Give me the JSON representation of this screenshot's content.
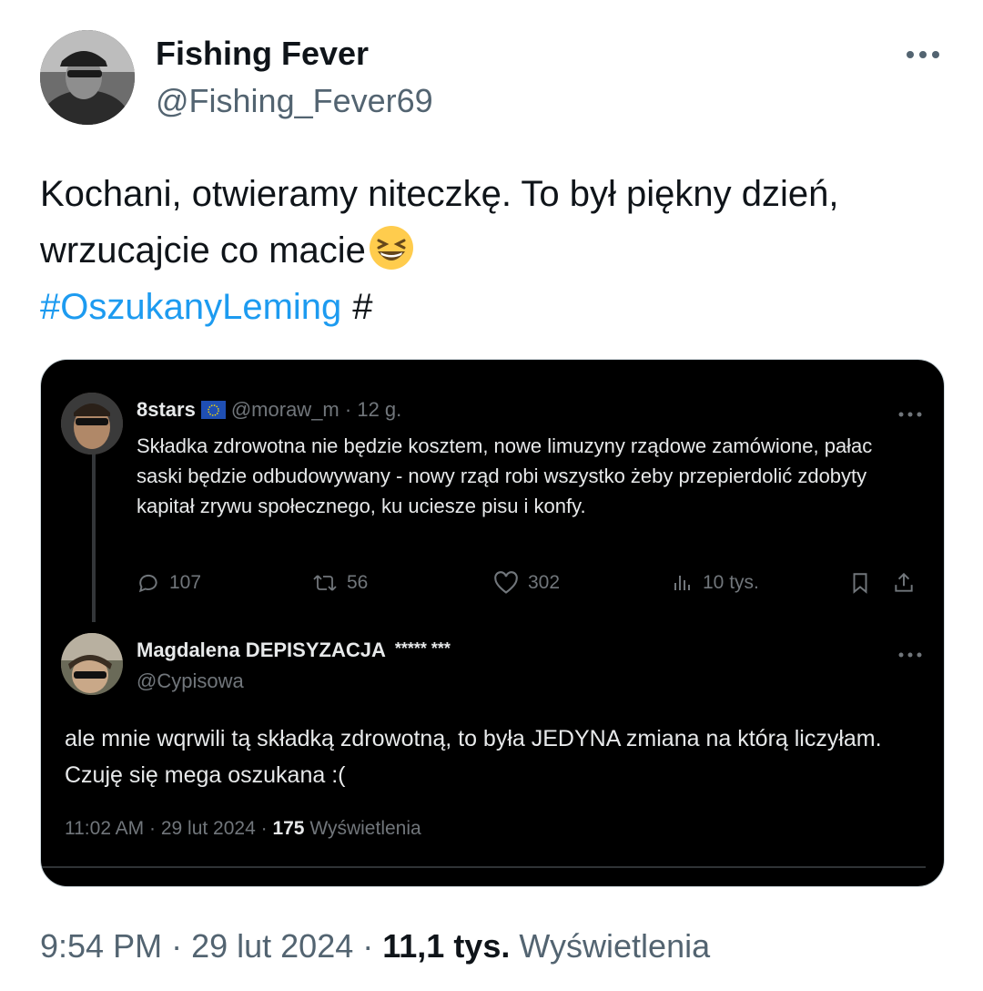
{
  "author": {
    "name": "Fishing Fever",
    "handle": "@Fishing_Fever69"
  },
  "tweet": {
    "text_line1": "Kochani, otwieramy niteczkę. To był piękny dzień,",
    "text_line2": "wrzucajcie co macie",
    "emoji": "laughing-emoji",
    "hashtag": "#OszukanyLeming",
    "extra_hash": "#"
  },
  "embedded": {
    "quoted": {
      "name": "8stars",
      "badge": "eu-flag-icon",
      "handle": "@moraw_m",
      "separator": "·",
      "age": "12 g.",
      "text": "Składka zdrowotna nie będzie kosztem, nowe limuzyny rządowe zamówione, pałac saski będzie odbudowywany - nowy rząd robi wszystko żeby przepierdolić zdobyty kapitał zrywu społecznego, ku uciesze pisu i konfy.",
      "replies": "107",
      "retweets": "56",
      "likes": "302",
      "views": "10 tys."
    },
    "reply": {
      "name": "Magdalena DEPISYZACJA",
      "stars": "***** ***",
      "handle": "@Cypisowa",
      "text": "ale mnie wqrwili tą składką zdrowotną, to była JEDYNA  zmiana na którą liczyłam. Czuję się mega oszukana :(",
      "time": "11:02 AM",
      "date": "29 lut 2024",
      "views_count": "175",
      "views_label": "Wyświetlenia"
    }
  },
  "footer": {
    "time": "9:54 PM",
    "date": "29 lut 2024",
    "views_count": "11,1 tys.",
    "views_label": "Wyświetlenia"
  },
  "colors": {
    "link": "#1d9bf0",
    "secondary": "#536471",
    "embed_bg": "#000000"
  }
}
